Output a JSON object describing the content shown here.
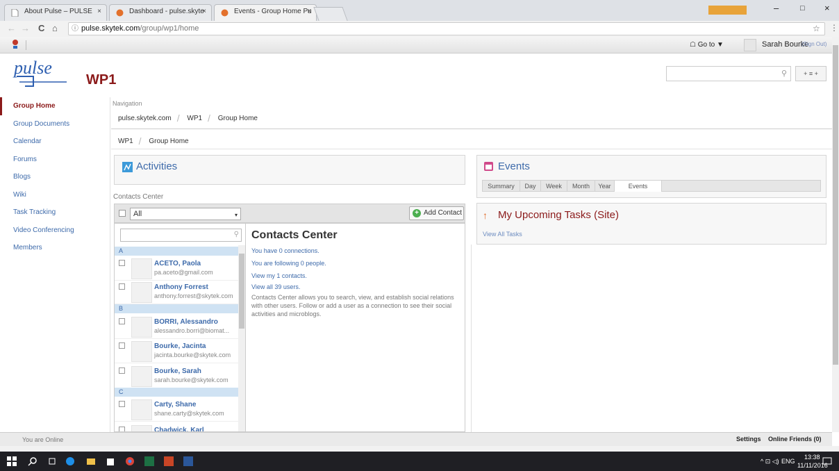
{
  "browser": {
    "tabs": [
      {
        "label": "About Pulse – PULSE"
      },
      {
        "label": "Dashboard - pulse.skyte"
      },
      {
        "label": "Events - Group Home Pu"
      }
    ],
    "close_glyph": "×",
    "window_controls": {
      "minimize": "–",
      "maximize": "□",
      "close": "×"
    },
    "nav": {
      "back": "←",
      "forward": "→",
      "reload": "C",
      "home": "⌂"
    },
    "url_host": "pulse.skytek.com",
    "url_path": "/group/wp1/home",
    "info_glyph": "ⓘ",
    "star_glyph": "☆",
    "menu_glyph": "⋮"
  },
  "site_bar": {
    "goto_label": "Go to ▼",
    "user_name": "Sarah Bourke",
    "sign_out": "(Sign Out)"
  },
  "header": {
    "logo_text": "pulse",
    "group_title": "WP1",
    "search_glyph": "⚲",
    "search_button": "+ ≡ +"
  },
  "sidebar": {
    "items": [
      {
        "label": "Group Home"
      },
      {
        "label": "Group Documents"
      },
      {
        "label": "Calendar"
      },
      {
        "label": "Forums"
      },
      {
        "label": "Blogs"
      },
      {
        "label": "Wiki"
      },
      {
        "label": "Task Tracking"
      },
      {
        "label": "Video Conferencing"
      },
      {
        "label": "Members"
      }
    ]
  },
  "navigation": {
    "label": "Navigation",
    "crumbs": [
      "pulse.skytek.com",
      "WP1",
      "Group Home"
    ],
    "sub_crumbs": [
      "WP1",
      "Group Home"
    ],
    "sep": "/"
  },
  "activities": {
    "title": "Activities"
  },
  "contacts": {
    "section_label": "Contacts Center",
    "filter_value": "All",
    "filter_arrow": "▾",
    "add_contact": "Add Contact",
    "add_plus": "+",
    "search_glyph": "⚲",
    "letters": [
      "A",
      "B",
      "C"
    ],
    "list": [
      {
        "name": "ACETO, Paola",
        "email": "pa.aceto@gmail.com"
      },
      {
        "name": "Anthony Forrest",
        "email": "anthony.forrest@skytek.com"
      },
      {
        "name": "BORRI, Alessandro",
        "email": "alessandro.borri@biomat..."
      },
      {
        "name": "Bourke, Jacinta",
        "email": "jacinta.bourke@skytek.com"
      },
      {
        "name": "Bourke, Sarah",
        "email": "sarah.bourke@skytek.com"
      },
      {
        "name": "Carty, Shane",
        "email": "shane.carty@skytek.com"
      },
      {
        "name": "Chadwick, Karl",
        "email": ""
      }
    ],
    "heading": "Contacts Center",
    "links": [
      "You have 0 connections.",
      "You are following 0 people.",
      "View my 1 contacts.",
      "View all 39 users."
    ],
    "description": "Contacts Center allows you to search, view, and establish social relations with other users. Follow or add a user as a connection to see their social activities and microblogs."
  },
  "events": {
    "title": "Events",
    "tabs": [
      "Summary",
      "Day",
      "Week",
      "Month",
      "Year",
      "Events"
    ],
    "active_tab": "Events"
  },
  "tasks": {
    "title": "My Upcoming Tasks (Site)",
    "view_all": "View All Tasks"
  },
  "bottom_bar": {
    "status": "You are Online",
    "settings": "Settings",
    "online_friends": "Online Friends (0)"
  },
  "taskbar": {
    "lang": "ENG",
    "time": "13:38",
    "date": "11/11/2016",
    "tray": "^ ⊡ ◁)"
  },
  "colors": {
    "accent": "#8b1a1a",
    "link": "#3d6aaa",
    "task_icon": "#e06c2b"
  }
}
